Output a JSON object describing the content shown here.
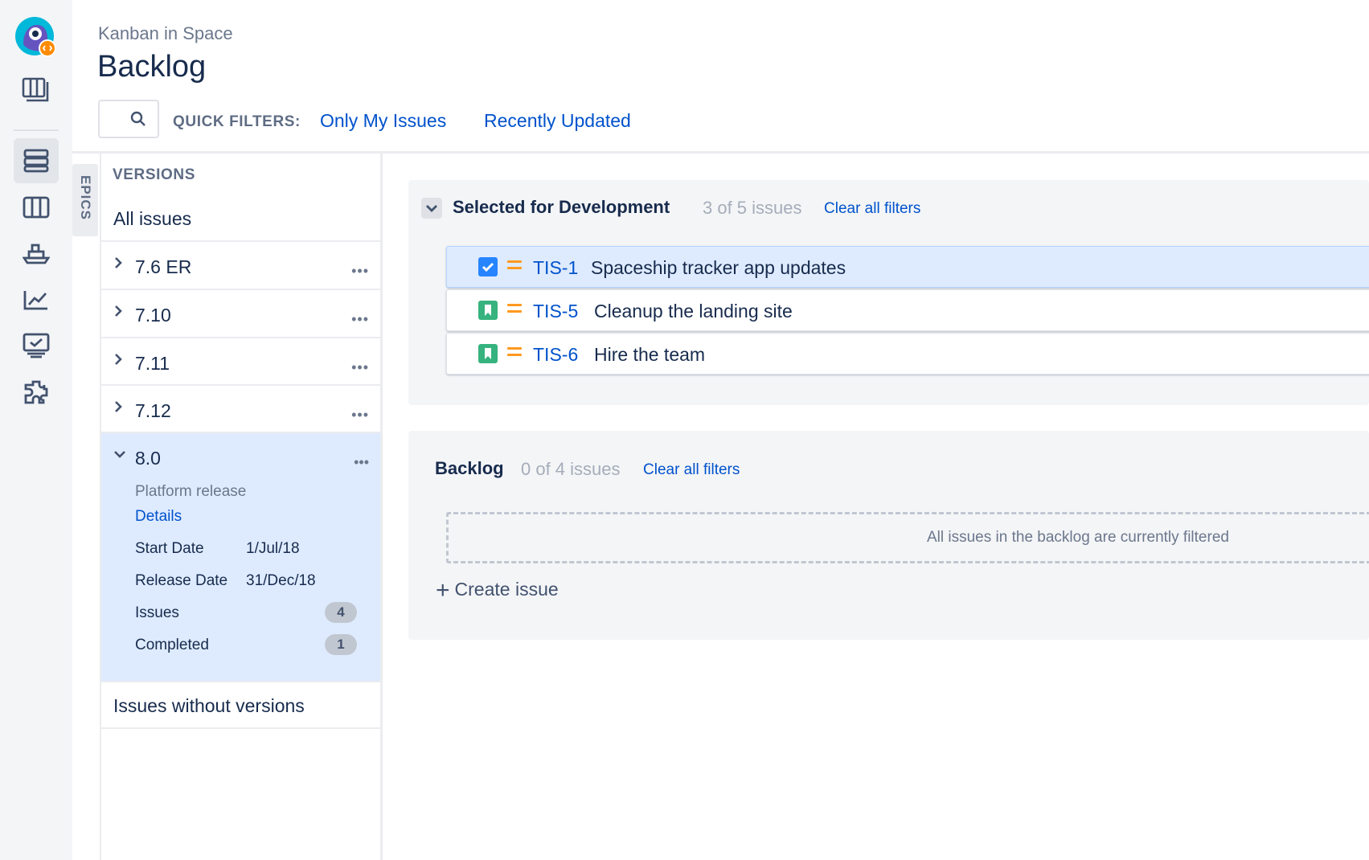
{
  "header": {
    "breadcrumb": "Kanban in Space",
    "title": "Backlog",
    "quick_filters_label": "QUICK FILTERS:",
    "quick_filters": [
      "Only My Issues",
      "Recently Updated"
    ]
  },
  "epics_tab": "EPICS",
  "versions": {
    "heading": "VERSIONS",
    "all_issues": "All issues",
    "items": [
      {
        "name": "7.6 ER",
        "more": "•••"
      },
      {
        "name": "7.10",
        "more": "•••"
      },
      {
        "name": "7.11",
        "more": "•••"
      },
      {
        "name": "7.12",
        "more": "•••"
      }
    ],
    "expanded": {
      "name": "8.0",
      "more": "•••",
      "description": "Platform release",
      "details_link": "Details",
      "start_label": "Start Date",
      "start_value": "1/Jul/18",
      "release_label": "Release Date",
      "release_value": "31/Dec/18",
      "issues_label": "Issues",
      "issues_count": "4",
      "completed_label": "Completed",
      "completed_count": "1"
    },
    "without": "Issues without versions"
  },
  "sprint": {
    "title": "Selected for Development",
    "count": "3 of 5 issues",
    "clear": "Clear all filters",
    "issues": [
      {
        "key": "TIS-1",
        "summary": "Spaceship tracker app updates",
        "type": "task-icon",
        "selected": true
      },
      {
        "key": "TIS-5",
        "summary": "Cleanup the landing site",
        "type": "story-icon",
        "selected": false
      },
      {
        "key": "TIS-6",
        "summary": "Hire the team",
        "type": "story-icon",
        "selected": false
      }
    ]
  },
  "backlog": {
    "title": "Backlog",
    "count": "0 of 4 issues",
    "clear": "Clear all filters",
    "empty_message": "All issues in the backlog are currently filtered",
    "create_label": "Create issue"
  },
  "colors": {
    "accent": "#0052cc",
    "selected_bg": "#deebff",
    "story": "#36b37e",
    "task": "#2684ff",
    "priority_medium": "#ff991f"
  }
}
